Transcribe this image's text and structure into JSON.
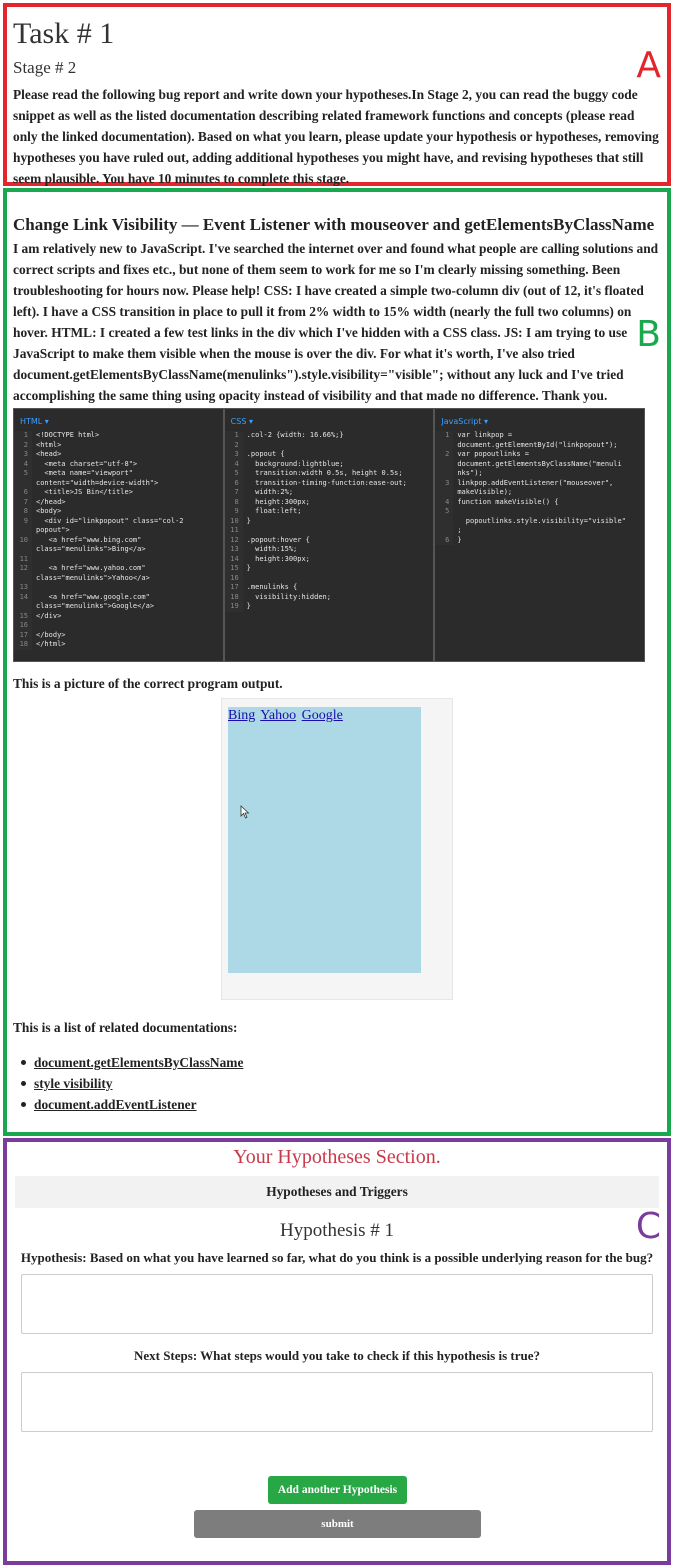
{
  "section_a": {
    "corner_label": "A",
    "task_title": "Task # 1",
    "stage_title": "Stage # 2",
    "instructions": "Please read the following bug report and write down your hypotheses.In Stage 2, you can read the buggy code snippet as well as the listed documentation describing related framework functions and concepts (please read only the linked documentation). Based on what you learn, please update your hypothesis or hypotheses, removing hypotheses you have ruled out, adding additional hypotheses you might have, and revising hypotheses that still seem plausible. You have 10 minutes to complete this stage."
  },
  "section_b": {
    "corner_label": "B",
    "post_title": "Change Link Visibility — Event Listener with mouseover and getElementsByClassName",
    "post_body": "I am relatively new to JavaScript. I've searched the internet over and found what people are calling solutions and correct scripts and fixes etc., but none of them seem to work for me so I'm clearly missing something. Been troubleshooting for hours now. Please help! CSS: I have created a simple two-column div (out of 12, it's floated left). I have a CSS transition in place to pull it from 2% width to 15% width (nearly the full two columns) on hover. HTML: I created a few test links in the div which I've hidden with a CSS class. JS: I am trying to use JavaScript to make them visible when the mouse is over the div. For what it's worth, I've also tried document.getElementsByClassName(menulinks\").style.visibility=\"visible\"; without any luck and I've tried accomplishing the same thing using opacity instead of visibility and that made no difference. Thank you.",
    "code": {
      "html_tab": "HTML ▾",
      "css_tab": "CSS ▾",
      "js_tab": "JavaScript ▾",
      "html_gutter": "1\n2\n3\n4\n5\n\n6\n7\n8\n9\n\n10\n\n11\n12\n\n13\n14\n\n15\n16\n17\n18",
      "html_code": "<!DOCTYPE html>\n<html>\n<head>\n  <meta charset=\"utf-8\">\n  <meta name=\"viewport\"\ncontent=\"width=device-width\">\n  <title>JS Bin</title>\n</head>\n<body>\n  <div id=\"linkpopout\" class=\"col-2\npopout\">\n   <a href=\"www.bing.com\"\nclass=\"menulinks\">Bing</a>\n\n   <a href=\"www.yahoo.com\"\nclass=\"menulinks\">Yahoo</a>\n\n   <a href=\"www.google.com\"\nclass=\"menulinks\">Google</a>\n</div>\n\n</body>\n</html>",
      "css_gutter": "1\n2\n3\n4\n5\n6\n7\n8\n9\n10\n11\n12\n13\n14\n15\n16\n17\n18\n19",
      "css_code": ".col-2 {width: 16.66%;}\n\n.popout {\n  background:lightblue;\n  transition:width 0.5s, height 0.5s;\n  transition-timing-function:ease-out;\n  width:2%;\n  height:300px;\n  float:left;\n}\n\n.popout:hover {\n  width:15%;\n  height:300px;\n}\n\n.menulinks {\n  visibility:hidden;\n}",
      "js_gutter": "1\n\n2\n\n\n3\n\n4\n5\n\n\n6",
      "js_code": "var linkpop =\ndocument.getElementById(\"linkpopout\");\nvar popoutlinks =\ndocument.getElementsByClassName(\"menuli\nnks\");\nlinkpop.addEventListener(\"mouseover\",\nmakeVisible);\nfunction makeVisible() {\n\n  popoutlinks.style.visibility=\"visible\"\n;\n}"
    },
    "output_caption": "This is a picture of the correct program output.",
    "output_links": [
      "Bing",
      "Yahoo",
      "Google"
    ],
    "docs_caption": "This is a list of related documentations:",
    "docs": [
      "document.getElementsByClassName",
      "style visibility",
      "document.addEventListener"
    ]
  },
  "section_c": {
    "corner_label": "C",
    "section_title": "Your Hypotheses Section.",
    "tab_label": "Hypotheses and Triggers",
    "hypothesis_title": "Hypothesis # 1",
    "hypothesis_question": "Hypothesis: Based on what you have learned so far, what do you think is a possible underlying reason for the bug?",
    "hypothesis_value": "",
    "next_steps_question": "Next Steps: What steps would you take to check if this hypothesis is true?",
    "next_steps_value": "",
    "add_button": "Add another Hypothesis",
    "submit_button": "submit"
  },
  "colors": {
    "section_a_border": "#e3262b",
    "section_b_border": "#1aa84f",
    "section_c_border": "#7b3c9e",
    "add_button": "#28a745",
    "submit_button": "#7d7d7d",
    "output_box": "#add8e6"
  }
}
